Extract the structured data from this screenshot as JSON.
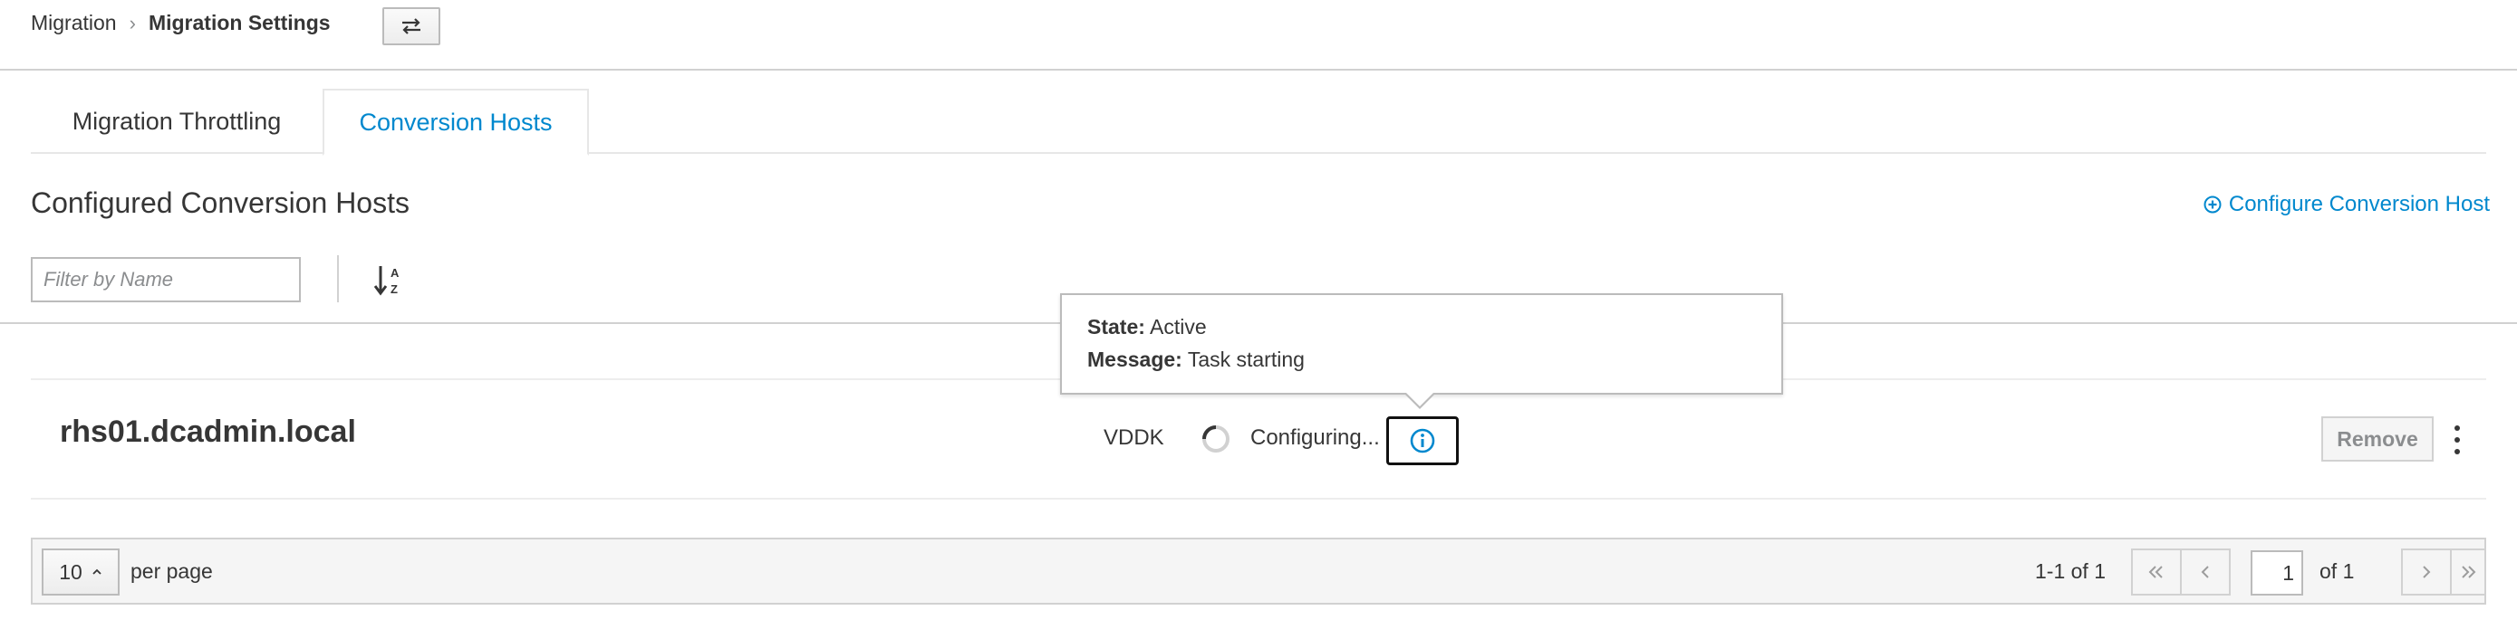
{
  "breadcrumb": {
    "parent": "Migration",
    "separator": "›",
    "current": "Migration Settings"
  },
  "tabs": [
    {
      "label": "Migration Throttling",
      "active": false
    },
    {
      "label": "Conversion Hosts",
      "active": true
    }
  ],
  "section": {
    "title": "Configured Conversion Hosts",
    "configure_label": "Configure Conversion Host"
  },
  "filter": {
    "placeholder": "Filter by Name",
    "value": ""
  },
  "hosts": [
    {
      "name": "rhs01.dcadmin.local",
      "transport": "VDDK",
      "status": "Configuring...",
      "remove_label": "Remove"
    }
  ],
  "popover": {
    "state_label": "State:",
    "state_value": "Active",
    "message_label": "Message:",
    "message_value": "Task starting"
  },
  "pagination": {
    "per_page": "10",
    "per_page_label": "per page",
    "range": "1-1 of 1",
    "page": "1",
    "of_pages": "of 1"
  },
  "colors": {
    "accent": "#0088ce",
    "text": "#363636",
    "border": "#d1d1d1"
  },
  "icons": {
    "swap": "swap-arrows-icon",
    "sort": "sort-alpha-asc-icon",
    "info": "info-circle-icon",
    "add": "plus-circle-icon",
    "kebab": "kebab-vertical-icon"
  }
}
